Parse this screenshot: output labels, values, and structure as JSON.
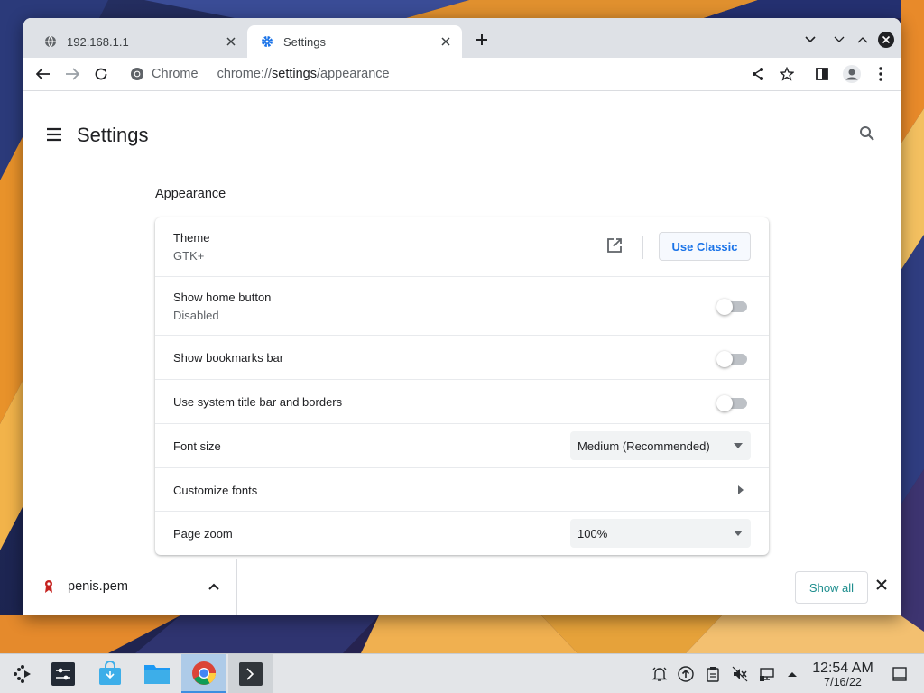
{
  "browser": {
    "tabs": [
      {
        "title": "192.168.1.1",
        "icon": "globe-icon"
      },
      {
        "title": "Settings",
        "icon": "gear-icon"
      }
    ],
    "omnibox": {
      "site_label": "Chrome",
      "url_prefix": "chrome://",
      "url_host": "settings",
      "url_path": "/appearance"
    }
  },
  "settings": {
    "page_title": "Settings",
    "section_title": "Appearance",
    "rows": {
      "theme": {
        "label": "Theme",
        "value": "GTK+",
        "button": "Use Classic"
      },
      "home_button": {
        "label": "Show home button",
        "status": "Disabled",
        "enabled": false
      },
      "bookmarks_bar": {
        "label": "Show bookmarks bar",
        "enabled": false
      },
      "title_bar": {
        "label": "Use system title bar and borders",
        "enabled": false
      },
      "font_size": {
        "label": "Font size",
        "value": "Medium (Recommended)"
      },
      "customize_fonts": {
        "label": "Customize fonts"
      },
      "page_zoom": {
        "label": "Page zoom",
        "value": "100%"
      }
    }
  },
  "downloads": {
    "file_name": "penis.pem",
    "show_all": "Show all"
  },
  "taskbar": {
    "apps": [
      "app-launcher-icon",
      "system-settings-icon",
      "discover-store-icon",
      "file-manager-icon",
      "chrome-icon",
      "terminal-icon"
    ],
    "tray": [
      "notifications-bell-icon",
      "update-icon",
      "clipboard-icon",
      "volume-muted-icon",
      "network-icon",
      "tray-expand-icon"
    ],
    "time": "12:54 AM",
    "date": "7/16/22"
  },
  "colors": {
    "accent": "#1a73e8",
    "tab_strip": "#dee1e6",
    "taskbar": "#e3e5e8",
    "active_app": "#aecbe8"
  }
}
